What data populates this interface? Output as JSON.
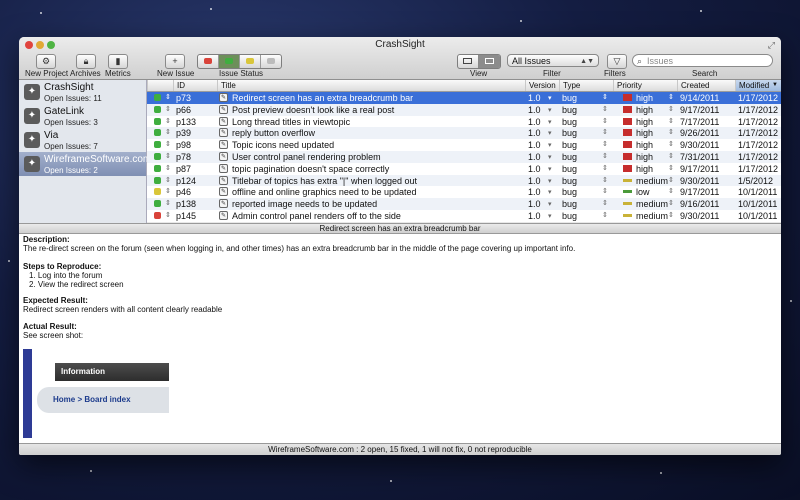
{
  "window": {
    "title": "CrashSight"
  },
  "toolbar": {
    "new_project": "New Project",
    "archives": "Archives",
    "metrics": "Metrics",
    "new_issue": "New Issue",
    "issue_status": "Issue Status",
    "view": "View",
    "filter": "Filter",
    "filter_value": "All Issues",
    "filters": "Filters",
    "search": "Search",
    "search_placeholder": "Issues"
  },
  "sidebar": {
    "projects": [
      {
        "name": "CrashSight",
        "count": "Open Issues: 11"
      },
      {
        "name": "GateLink",
        "count": "Open Issues: 3"
      },
      {
        "name": "Via",
        "count": "Open Issues: 7"
      },
      {
        "name": "WireframeSoftware.com",
        "count": "Open Issues: 2"
      }
    ]
  },
  "table": {
    "columns": [
      "ID",
      "Title",
      "Version",
      "Type",
      "Priority",
      "Created",
      "Modified"
    ],
    "rows": [
      {
        "status": "green",
        "id": "p73",
        "title": "Redirect screen has an extra breadcrumb bar",
        "version": "1.0",
        "type": "bug",
        "priority": "high",
        "created": "9/14/2011",
        "modified": "1/17/2012"
      },
      {
        "status": "green",
        "id": "p66",
        "title": "Post preview doesn't look like a real post",
        "version": "1.0",
        "type": "bug",
        "priority": "high",
        "created": "9/17/2011",
        "modified": "1/17/2012"
      },
      {
        "status": "green",
        "id": "p133",
        "title": "Long thread titles in viewtopic",
        "version": "1.0",
        "type": "bug",
        "priority": "high",
        "created": "7/17/2011",
        "modified": "1/17/2012"
      },
      {
        "status": "green",
        "id": "p39",
        "title": "reply button overflow",
        "version": "1.0",
        "type": "bug",
        "priority": "high",
        "created": "9/26/2011",
        "modified": "1/17/2012"
      },
      {
        "status": "green",
        "id": "p98",
        "title": "Topic icons need updated",
        "version": "1.0",
        "type": "bug",
        "priority": "high",
        "created": "9/30/2011",
        "modified": "1/17/2012"
      },
      {
        "status": "green",
        "id": "p78",
        "title": "User control panel rendering problem",
        "version": "1.0",
        "type": "bug",
        "priority": "high",
        "created": "7/31/2011",
        "modified": "1/17/2012"
      },
      {
        "status": "green",
        "id": "p87",
        "title": "topic pagination doesn't space correctly",
        "version": "1.0",
        "type": "bug",
        "priority": "high",
        "created": "9/17/2011",
        "modified": "1/17/2012"
      },
      {
        "status": "green",
        "id": "p124",
        "title": "Titlebar of topics has extra \"|\" when logged out",
        "version": "1.0",
        "type": "bug",
        "priority": "medium",
        "created": "9/30/2011",
        "modified": "1/5/2012"
      },
      {
        "status": "yellow",
        "id": "p46",
        "title": "offline and online graphics need to be updated",
        "version": "1.0",
        "type": "bug",
        "priority": "low",
        "created": "9/17/2011",
        "modified": "10/1/2011"
      },
      {
        "status": "green",
        "id": "p138",
        "title": "reported image needs to be updated",
        "version": "1.0",
        "type": "bug",
        "priority": "medium",
        "created": "9/16/2011",
        "modified": "10/1/2011"
      },
      {
        "status": "red",
        "id": "p145",
        "title": "Admin control panel renders off to the side",
        "version": "1.0",
        "type": "bug",
        "priority": "medium",
        "created": "9/30/2011",
        "modified": "10/1/2011"
      }
    ]
  },
  "detail": {
    "subject": "Redirect screen has an extra breadcrumb bar",
    "description_heading": "Description:",
    "description": "The re-direct screen on the forum (seen when logging in, and other times) has an extra breadcrumb bar in the middle of the page covering up important info.",
    "steps_heading": "Steps to Reproduce:",
    "step1": "1.    Log into the forum",
    "step2": "2.    View the redirect screen",
    "expected_heading": "Expected Result:",
    "expected": "Redirect screen renders with all content clearly readable",
    "actual_heading": "Actual Result:",
    "actual": "See screen shot:",
    "shot_info": "Information",
    "shot_crumb": "Home > Board index"
  },
  "footer": {
    "text": "WireframeSoftware.com  :  2 open,  15 fixed,  1 will not fix,  0 not reproducible"
  },
  "colors": {
    "status_green": "#3fae3f",
    "status_yellow": "#d9c63a",
    "status_red": "#d9433a",
    "selection": "#3a6fd8",
    "prio_high": "#c62d2d",
    "prio_medium": "#c9b237",
    "prio_low": "#4a9a3a"
  }
}
